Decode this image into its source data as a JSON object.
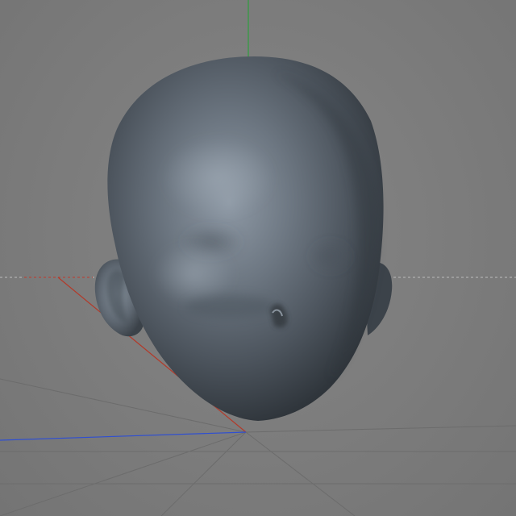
{
  "viewport": {
    "background_color": "#7b7b7b",
    "grid_color": "#6e6e6e",
    "grid_line_color_light": "#8a8a8a"
  },
  "axes": {
    "x_axis_color": "#c0392b",
    "y_axis_color": "#2e9e3e",
    "z_axis_color": "#2f4fd1",
    "horizon_guide_color": "#b7b7b7"
  },
  "model": {
    "shape": "sculpted head mesh",
    "material_color": "#5d6670",
    "highlight_color": "#9aa6b2",
    "shadow_color": "#2e343a"
  }
}
